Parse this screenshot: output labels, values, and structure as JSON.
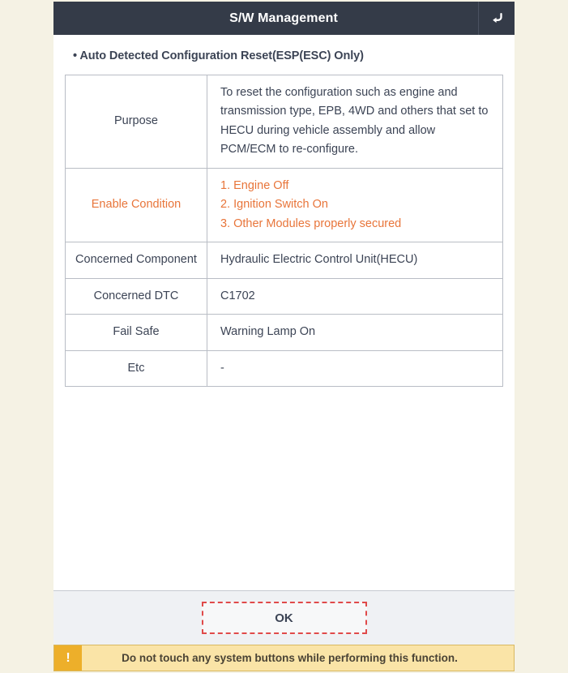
{
  "window": {
    "title": "S/W Management",
    "back_icon": "return-arrow-icon"
  },
  "content": {
    "subtitle": "• Auto Detected Configuration Reset(ESP(ESC) Only)",
    "table": {
      "rows": [
        {
          "label": "Purpose",
          "value": "To reset the configuration such as engine and transmission type, EPB, 4WD and others that set to HECU during vehicle assembly and allow PCM/ECM to re-configure.",
          "highlight": false
        },
        {
          "label": "Enable Condition",
          "value": "1. Engine Off\n2. Ignition Switch On\n3. Other Modules properly secured",
          "highlight": true
        },
        {
          "label": "Concerned Component",
          "value": "Hydraulic Electric Control Unit(HECU)",
          "highlight": false
        },
        {
          "label": "Concerned DTC",
          "value": "C1702",
          "highlight": false
        },
        {
          "label": "Fail Safe",
          "value": "Warning Lamp On",
          "highlight": false
        },
        {
          "label": "Etc",
          "value": "-",
          "highlight": false
        }
      ]
    }
  },
  "footer": {
    "ok_label": "OK"
  },
  "warning": {
    "icon": "exclamation-icon",
    "icon_glyph": "!",
    "text": "Do not touch any system buttons while performing this function."
  },
  "colors": {
    "page_background": "#f5f2e4",
    "titlebar": "#343b48",
    "text_primary": "#3c4455",
    "highlight_orange": "#e8753a",
    "footer_background": "#eff1f4",
    "ok_border_red": "#e04a4a",
    "warning_background": "#fae4a7",
    "warning_icon_background": "#edaf2a",
    "table_border": "#b9bdc5"
  }
}
